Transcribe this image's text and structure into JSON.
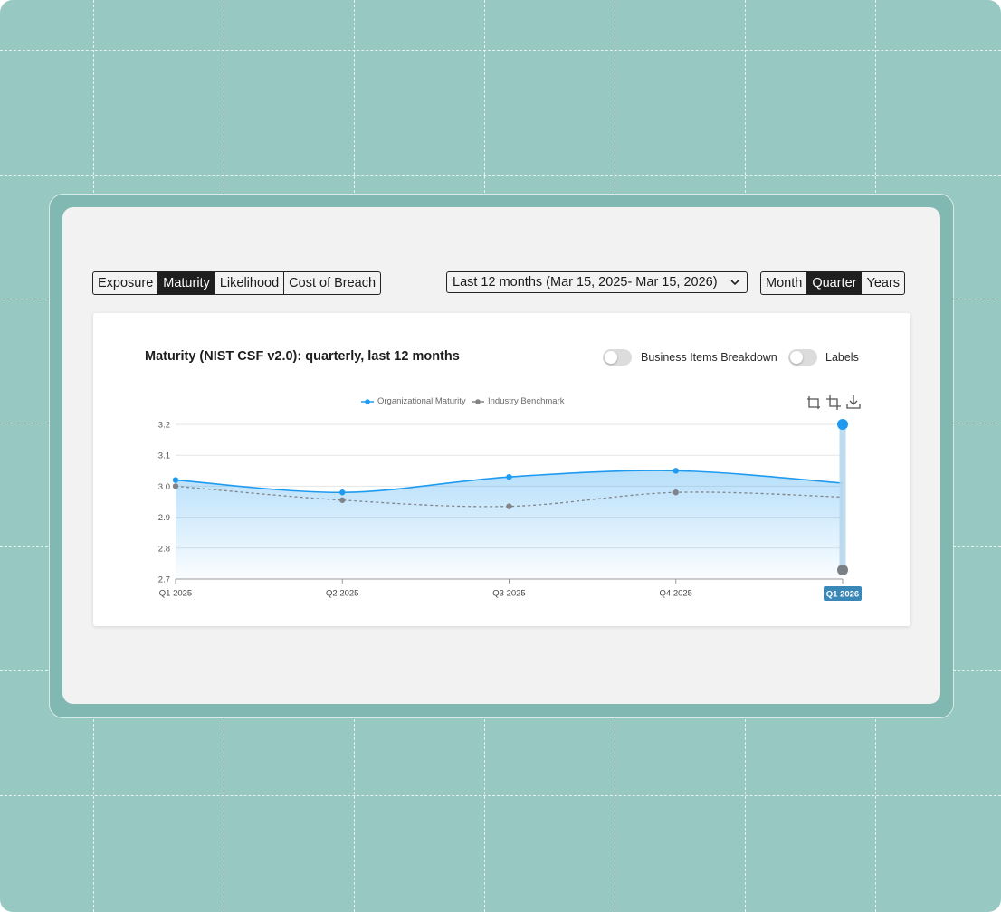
{
  "tabs": {
    "metric": [
      "Exposure",
      "Maturity",
      "Likelihood",
      "Cost of Breach"
    ],
    "metric_active": 1,
    "period": [
      "Month",
      "Quarter",
      "Years"
    ],
    "period_active": 1
  },
  "date_range": {
    "label": "Last 12 months (Mar 15, 2025- Mar 15, 2026)"
  },
  "toggles": {
    "breakdown_label": "Business Items Breakdown",
    "labels_label": "Labels"
  },
  "colors": {
    "primary": "#1e9bf0",
    "benchmark": "#808488",
    "badge": "#3a88b8",
    "background": "#97c8c2"
  },
  "icons": [
    "zoom-reset-icon",
    "zoom-select-icon",
    "download-icon",
    "chevron-down-icon"
  ],
  "chart_data": {
    "type": "area",
    "title": "Maturity (NIST CSF v2.0): quarterly, last 12 months",
    "categories": [
      "Q1 2025",
      "Q2 2025",
      "Q3 2025",
      "Q4 2025",
      "Q1 2026"
    ],
    "series": [
      {
        "name": "Organizational Maturity",
        "values": [
          3.02,
          2.98,
          3.03,
          3.05,
          3.01
        ],
        "color": "#1e9bf0",
        "style": "area"
      },
      {
        "name": "Industry Benchmark",
        "values": [
          3.0,
          2.955,
          2.935,
          2.98,
          2.965
        ],
        "color": "#808488",
        "style": "dashed-line"
      }
    ],
    "ylim": [
      2.7,
      3.2
    ],
    "yticks": [
      "3.2",
      "3.1",
      "3.0",
      "2.9",
      "2.8",
      "2.7"
    ],
    "highlighted_category": "Q1 2026",
    "legend_position": "top-center",
    "grid": true
  }
}
